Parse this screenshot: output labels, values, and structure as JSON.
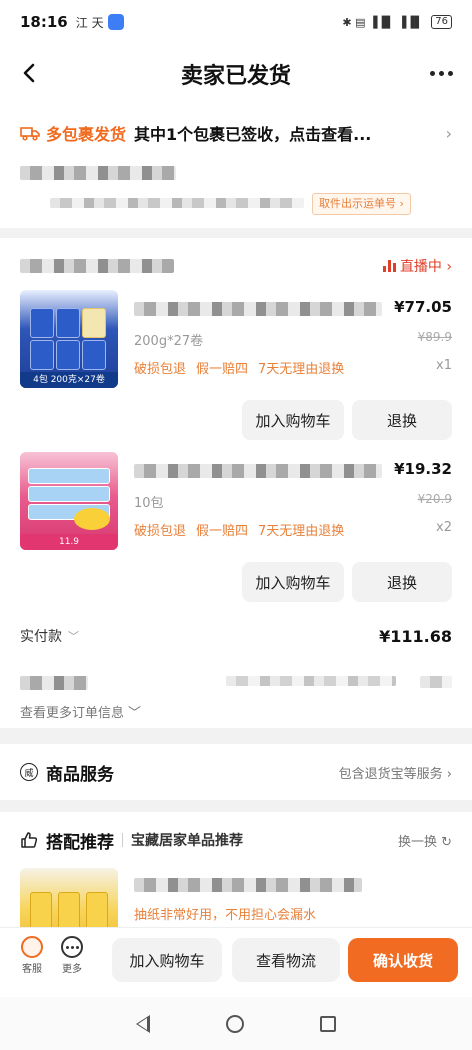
{
  "status_bar": {
    "time": "18:16",
    "left_icons": "江  天",
    "right_icons": "✱ ▤  ▐▐▌  ▐▐▌",
    "battery": "76"
  },
  "nav": {
    "title": "卖家已发货"
  },
  "package": {
    "label": "多包裹发货",
    "message": "其中1个包裹已签收，点击查看...",
    "tag": "取件出示运单号 ›"
  },
  "shop": {
    "live_label": "直播中 ›"
  },
  "items": [
    {
      "price": "¥77.05",
      "spec": "200g*27卷",
      "orig_price": "¥89.9",
      "promises": [
        "破损包退",
        "假一赔四",
        "7天无理由退换"
      ],
      "qty": "x1",
      "thumb_ribbon": "4包  200克×27卷",
      "add_cart": "加入购物车",
      "return": "退换"
    },
    {
      "price": "¥19.32",
      "spec": "10包",
      "orig_price": "¥20.9",
      "promises": [
        "破损包退",
        "假一赔四",
        "7天无理由退换"
      ],
      "qty": "x2",
      "thumb_ribbon": "11.9",
      "add_cart": "加入购物车",
      "return": "退换"
    }
  ],
  "paid": {
    "label": "实付款",
    "amount": "¥111.68"
  },
  "more_info": "查看更多订单信息",
  "service": {
    "icon_text": "威",
    "title": "商品服务",
    "right": "包含退货宝等服务 ›"
  },
  "recommend": {
    "title": "搭配推荐",
    "subtitle": "宝藏居家单品推荐",
    "swap": "换一换 ↻",
    "desc": "抽纸非常好用，不用担心会漏水"
  },
  "bottom": {
    "kefu": "客服",
    "more": "更多",
    "add_cart": "加入购物车",
    "logistics": "查看物流",
    "confirm": "确认收货"
  },
  "colors": {
    "accent": "#f26b22",
    "live": "#e0402b",
    "promise": "#e8813a"
  }
}
